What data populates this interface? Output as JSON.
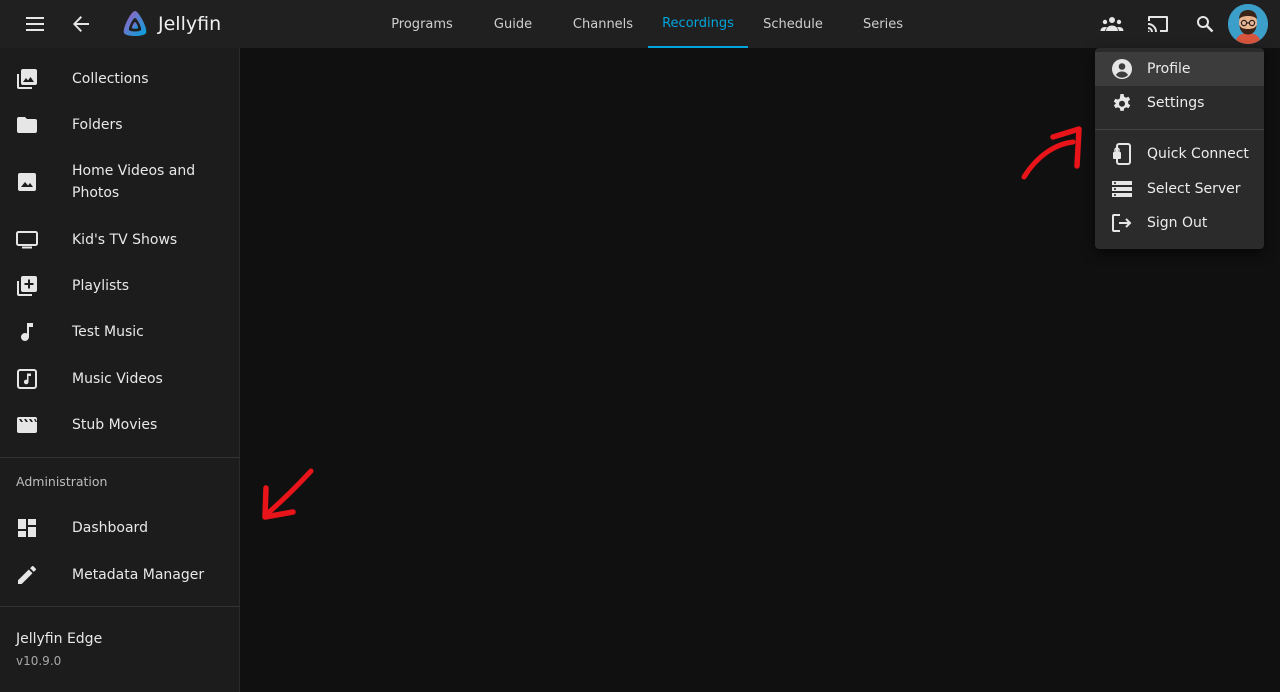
{
  "header": {
    "app_name": "Jellyfin",
    "tabs": [
      {
        "label": "Programs"
      },
      {
        "label": "Guide"
      },
      {
        "label": "Channels"
      },
      {
        "label": "Recordings",
        "active": true
      },
      {
        "label": "Schedule"
      },
      {
        "label": "Series"
      }
    ],
    "icons": [
      "menu-icon",
      "back-arrow-icon",
      "users-icon",
      "cast-icon",
      "search-icon",
      "avatar"
    ]
  },
  "sidebar": {
    "libraries": [
      {
        "label": "Collections",
        "icon": "collections-icon"
      },
      {
        "label": "Folders",
        "icon": "folder-icon"
      },
      {
        "label": "Home Videos and Photos",
        "icon": "photo-icon"
      },
      {
        "label": "Kid's TV Shows",
        "icon": "tv-icon"
      },
      {
        "label": "Playlists",
        "icon": "playlist-add-icon"
      },
      {
        "label": "Test Music",
        "icon": "music-note-icon"
      },
      {
        "label": "Music Videos",
        "icon": "music-video-icon"
      },
      {
        "label": "Stub Movies",
        "icon": "movie-icon"
      }
    ],
    "admin_title": "Administration",
    "admin": [
      {
        "label": "Dashboard",
        "icon": "dashboard-icon"
      },
      {
        "label": "Metadata Manager",
        "icon": "edit-icon"
      }
    ],
    "server_name": "Jellyfin Edge",
    "version": "v10.9.0"
  },
  "user_menu": {
    "items": [
      {
        "label": "Profile",
        "icon": "account-circle-icon"
      },
      {
        "label": "Settings",
        "icon": "gear-icon"
      },
      {
        "label": "Quick Connect",
        "icon": "phonelink-lock-icon"
      },
      {
        "label": "Select Server",
        "icon": "storage-icon"
      },
      {
        "label": "Sign Out",
        "icon": "logout-icon"
      }
    ]
  },
  "colors": {
    "accent": "#00a4dc",
    "header_bg": "#202020",
    "sidebar_bg": "#1c1c1c",
    "content_bg": "#101010",
    "menu_bg": "#2b2b2b",
    "annotation": "#e8141a"
  }
}
